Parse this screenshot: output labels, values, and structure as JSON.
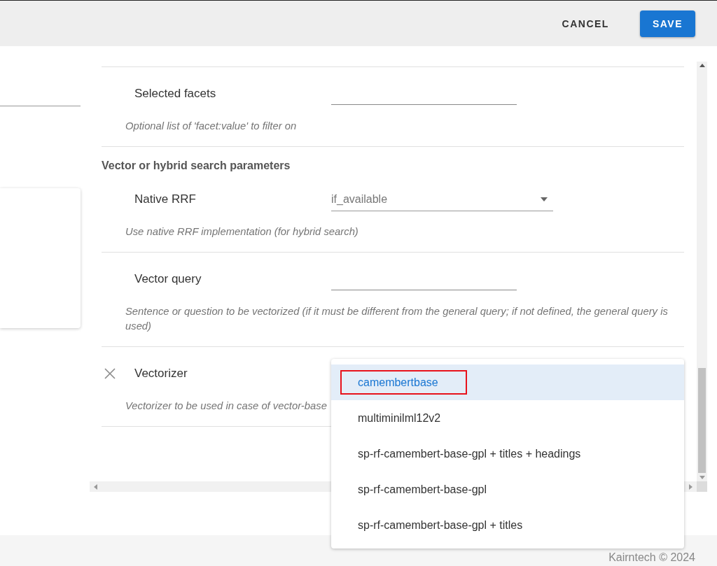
{
  "header": {
    "buttons": [
      {
        "label": "CANCEL",
        "kind": "text"
      },
      {
        "label": "SAVE",
        "kind": "primary"
      }
    ]
  },
  "rows": [
    {
      "kind": "text",
      "label": "Selected facets",
      "hint": "Optional list of 'facet:value' to filter on"
    },
    {
      "kind": "heading",
      "label": "Vector or hybrid search parameters"
    },
    {
      "kind": "select",
      "label": "Native RRF",
      "value": "if_available",
      "hint": "Use native RRF implementation (for hybrid search)"
    },
    {
      "kind": "text",
      "label": "Vector query",
      "hint": "Sentence or question to be vectorized (if it must be different from the general query; if not defined, the general query is used)"
    },
    {
      "kind": "plain",
      "label": "Vectorizer",
      "removable": true,
      "hint": "Vectorizer to be used in case of vector-base"
    }
  ],
  "dropdown": {
    "options": [
      {
        "label": "camembertbase",
        "selected": true,
        "highlighted": true
      },
      {
        "label": "multiminilml12v2",
        "selected": false,
        "highlighted": false
      },
      {
        "label": "sp-rf-camembert-base-gpl + titles + headings",
        "selected": false,
        "highlighted": false
      },
      {
        "label": "sp-rf-camembert-base-gpl",
        "selected": false,
        "highlighted": false
      },
      {
        "label": "sp-rf-camembert-base-gpl + titles",
        "selected": false,
        "highlighted": false
      }
    ]
  },
  "footer": {
    "text": "Kairntech © 2024"
  }
}
